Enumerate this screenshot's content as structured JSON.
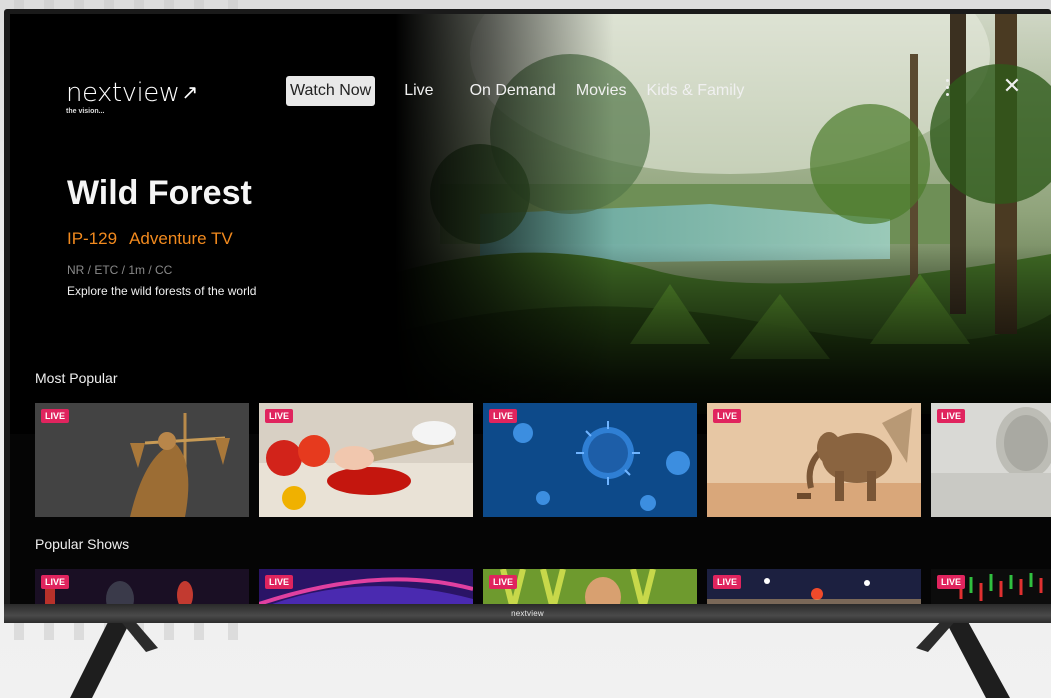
{
  "brand": {
    "name": "nextview",
    "tagline": "the vision...",
    "bezel_logo": "nextview"
  },
  "nav": {
    "items": [
      {
        "label": "Watch Now",
        "active": true
      },
      {
        "label": "Live",
        "active": false
      },
      {
        "label": "On Demand",
        "active": false
      },
      {
        "label": "Movies",
        "active": false
      },
      {
        "label": "Kids & Family",
        "active": false
      }
    ],
    "more_icon": "more-vertical-icon",
    "close_icon": "close-icon",
    "close_glyph": "✕"
  },
  "hero": {
    "title": "Wild Forest",
    "channel_number": "IP-129",
    "channel_name": "Adventure TV",
    "meta": "NR / ETC / 1m / CC",
    "description": "Explore the wild forests of the world"
  },
  "rows": [
    {
      "title": "Most Popular",
      "cards": [
        {
          "badge": "LIVE",
          "subject": "justice-statue"
        },
        {
          "badge": "LIVE",
          "subject": "cooking-vegetables"
        },
        {
          "badge": "LIVE",
          "subject": "virus-particles"
        },
        {
          "badge": "LIVE",
          "subject": "elephant-savanna"
        },
        {
          "badge": "LIVE",
          "subject": "coins"
        }
      ]
    },
    {
      "title": "Popular Shows",
      "cards": [
        {
          "badge": "LIVE",
          "subject": "chess"
        },
        {
          "badge": "LIVE",
          "subject": "neon-abstract"
        },
        {
          "badge": "LIVE",
          "subject": "plants"
        },
        {
          "badge": "LIVE",
          "subject": "stadium"
        },
        {
          "badge": "LIVE",
          "subject": "stock-chart"
        }
      ]
    }
  ],
  "colors": {
    "accent_orange": "#f28a1e",
    "live_badge": "#e0245e",
    "active_tab_bg": "#e9e9e9"
  }
}
